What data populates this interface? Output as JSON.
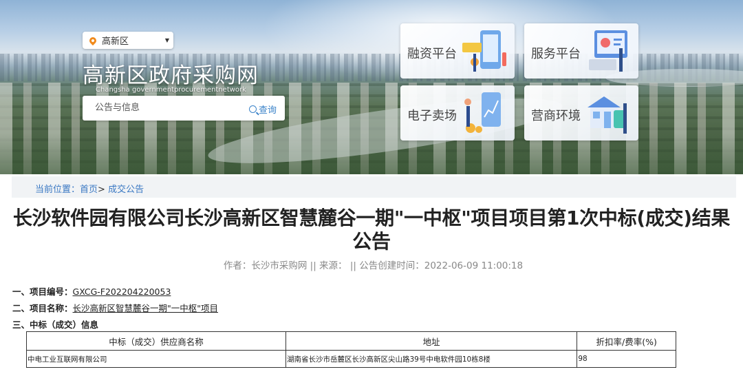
{
  "header": {
    "location": "高新区",
    "site_title": "高新区政府采购网",
    "site_subtitle": "Changsha governmentprocurementnetwork",
    "search": {
      "placeholder": "公告与信息",
      "button_label": "查询"
    },
    "tiles": [
      {
        "label": "融资平台",
        "icon": "finance-illustration"
      },
      {
        "label": "服务平台",
        "icon": "service-illustration"
      },
      {
        "label": "电子卖场",
        "icon": "e-mall-illustration"
      },
      {
        "label": "营商环境",
        "icon": "business-environment-illustration"
      }
    ]
  },
  "breadcrumb": {
    "prefix": "当前位置：",
    "items": [
      "首页",
      "成交公告"
    ],
    "separator": ">"
  },
  "article": {
    "title": "长沙软件园有限公司长沙高新区智慧麓谷一期\"一中枢\"项目项目第1次中标(成交)结果公告",
    "meta": "作者：长沙市采购网 || 来源： || 公告创建时间：2022-06-09 11:00:18",
    "sections": {
      "project_no_label": "一、项目编号：",
      "project_no": "GXCG-F202204220053",
      "project_name_label": "二、项目名称：",
      "project_name": "长沙高新区智慧麓谷一期\"一中枢\"项目",
      "award_label": "三、中标（成交）信息"
    },
    "table": {
      "headers": [
        "中标（成交）供应商名称",
        "地址",
        "折扣率/费率(%)"
      ],
      "rows": [
        [
          "中电工业互联网有限公司",
          "湖南省长沙市岳麓区长沙高新区尖山路39号中电软件园10栋8楼",
          "98"
        ]
      ]
    }
  },
  "colors": {
    "link": "#3a78c3",
    "search_button": "#3b83c9",
    "pin": "#f08a1c"
  }
}
